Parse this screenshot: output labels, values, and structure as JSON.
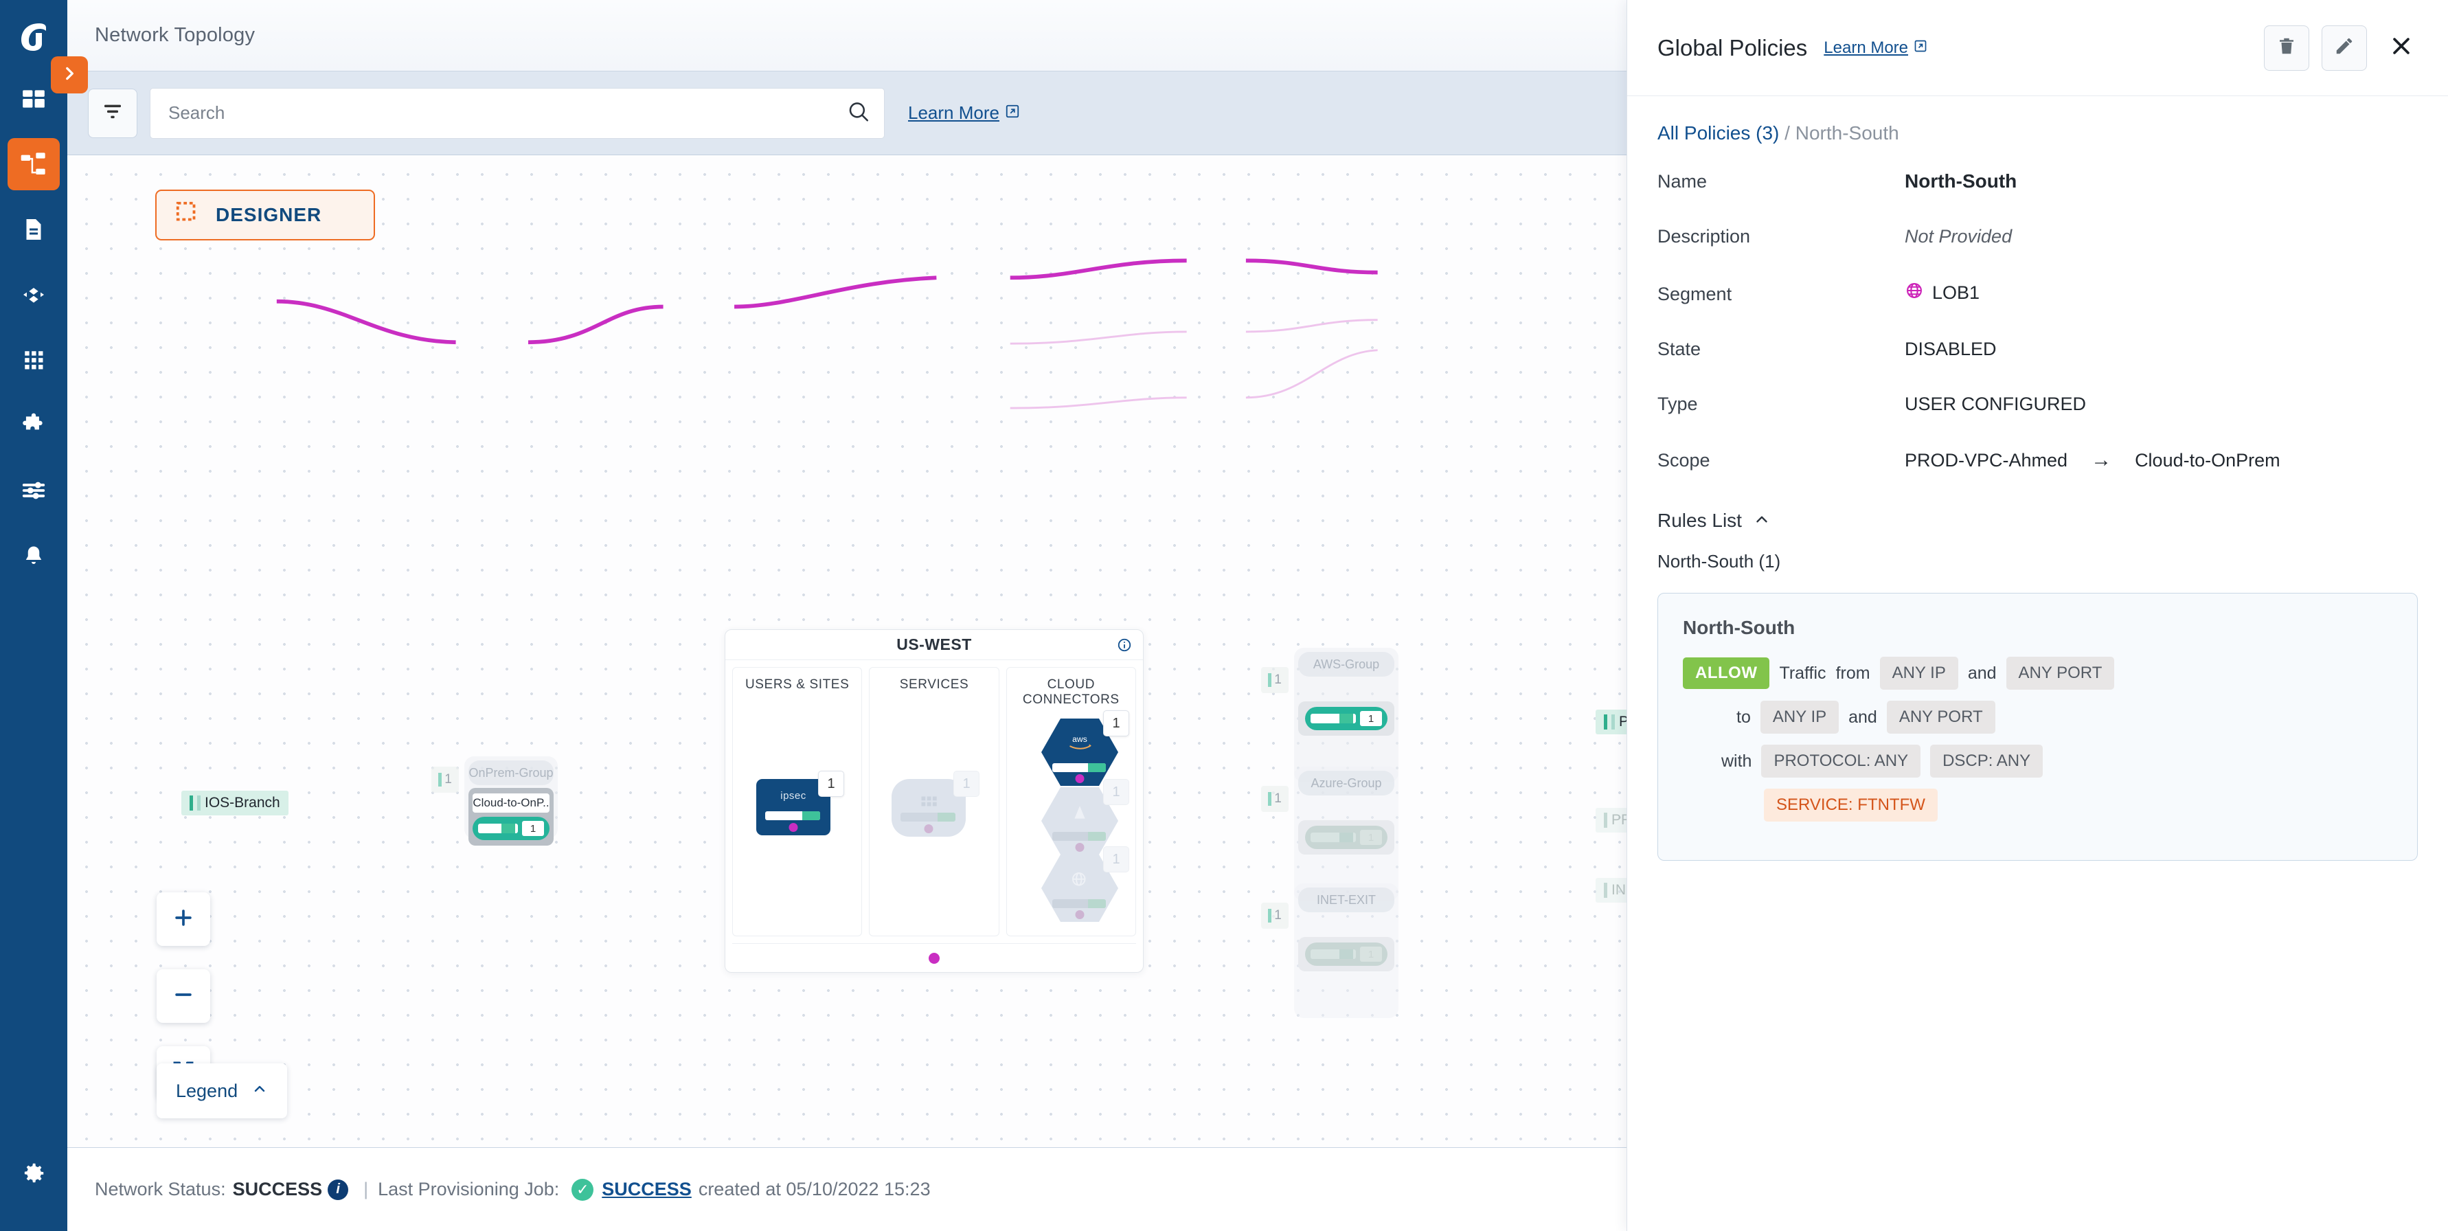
{
  "nav": {
    "logo": "arista-logo",
    "items": [
      {
        "name": "dashboard",
        "icon": "dashboard-icon",
        "active": false
      },
      {
        "name": "topology",
        "icon": "topology-icon",
        "active": true
      },
      {
        "name": "inventory",
        "icon": "document-icon",
        "active": false
      },
      {
        "name": "traffic",
        "icon": "diamond-flow-icon",
        "active": false
      },
      {
        "name": "apps",
        "icon": "grid-apps-icon",
        "active": false
      },
      {
        "name": "integrations",
        "icon": "puzzle-icon",
        "active": false
      },
      {
        "name": "settings-sliders",
        "icon": "sliders-icon",
        "active": false
      },
      {
        "name": "alerts",
        "icon": "bell-icon",
        "active": false
      }
    ],
    "bottom_item": {
      "name": "settings",
      "icon": "gear-icon"
    },
    "expand_tab_icon": "chevron-right-icon"
  },
  "topbar": {
    "title": "Network Topology"
  },
  "toolbar": {
    "filter_icon": "filter-icon",
    "search": {
      "placeholder": "Search",
      "value": "",
      "icon": "search-icon"
    },
    "learn_more": "Learn More",
    "learn_more_icon": "external-link-icon"
  },
  "canvas": {
    "designer_button": {
      "label": "DESIGNER",
      "icon": "marquee-select-icon"
    },
    "zoom_controls": [
      {
        "name": "zoom-in",
        "icon": "plus-icon"
      },
      {
        "name": "zoom-out",
        "icon": "minus-icon"
      },
      {
        "name": "fit-to-screen",
        "icon": "fit-screen-icon"
      }
    ],
    "legend": {
      "label": "Legend",
      "icon": "chevron-up-icon"
    },
    "region": {
      "title": "US-WEST",
      "info_icon": "info-icon",
      "columns": [
        "USERS & SITES",
        "SERVICES",
        "CLOUD CONNECTORS"
      ],
      "users_sites_node": {
        "label": "ipsec",
        "badge": "1"
      },
      "services_node": {
        "label": "",
        "badge": "1"
      },
      "cloud_connectors": [
        {
          "label": "aws",
          "badge": "1",
          "active": true
        },
        {
          "label": "azure",
          "badge": "1",
          "active": false
        },
        {
          "label": "internet",
          "badge": "1",
          "active": false
        }
      ]
    },
    "groups": [
      {
        "name": "OnPrem-Group",
        "count": "1",
        "node_label": "Cloud-to-OnP..",
        "pill_count": "1",
        "active": true
      },
      {
        "name": "AWS-Group",
        "count": "1",
        "node_label": "",
        "pill_count": "1",
        "active": true
      },
      {
        "name": "Azure-Group",
        "count": "1",
        "node_label": "",
        "pill_count": "1",
        "active": false
      },
      {
        "name": "INET-EXIT",
        "count": "1",
        "node_label": "",
        "pill_count": "1",
        "active": false
      }
    ],
    "endpoints": [
      {
        "label": "IOS-Branch",
        "active": true
      },
      {
        "label": "PROD-VPC-A..",
        "active": true
      },
      {
        "label": "PROD-Ahmed..",
        "active": false
      },
      {
        "label": "INET",
        "active": false
      }
    ]
  },
  "statusbar": {
    "network_status_label": "Network Status:",
    "network_status_value": "SUCCESS",
    "info_icon": "info-icon",
    "divider": "|",
    "job_label": "Last Provisioning Job:",
    "job_status": "SUCCESS",
    "job_check_icon": "check-circle-icon",
    "job_created": "created at 05/10/2022 15:23"
  },
  "panel": {
    "title": "Global Policies",
    "learn_more": "Learn More",
    "learn_more_icon": "external-link-icon",
    "actions": [
      {
        "name": "delete-policy",
        "icon": "trash-icon"
      },
      {
        "name": "edit-policy",
        "icon": "pencil-icon"
      },
      {
        "name": "close-panel",
        "icon": "close-icon"
      }
    ],
    "breadcrumb": {
      "root": "All Policies (3)",
      "separator": "/",
      "current": "North-South"
    },
    "fields": [
      {
        "key": "Name",
        "value": "North-South",
        "style": "strong"
      },
      {
        "key": "Description",
        "value": "Not Provided",
        "style": "muted-italic"
      },
      {
        "key": "Segment",
        "value": "LOB1",
        "icon": "globe-icon",
        "icon_color": "#cc22b8"
      },
      {
        "key": "State",
        "value": "DISABLED",
        "style": "normal"
      },
      {
        "key": "Type",
        "value": "USER CONFIGURED",
        "style": "normal"
      }
    ],
    "scope": {
      "key": "Scope",
      "from": "PROD-VPC-Ahmed",
      "arrow": "→",
      "to": "Cloud-to-OnPrem"
    },
    "rules": {
      "header": "Rules List",
      "collapse_icon": "chevron-up-icon",
      "group_label": "North-South (1)",
      "card": {
        "name": "North-South",
        "action": "ALLOW",
        "action_color": "#82c44b",
        "word_traffic": "Traffic",
        "word_from": "from",
        "word_and": "and",
        "word_to": "to",
        "word_with": "with",
        "src_ip": "ANY IP",
        "src_port": "ANY PORT",
        "dst_ip": "ANY IP",
        "dst_port": "ANY PORT",
        "protocol": "PROTOCOL: ANY",
        "dscp": "DSCP: ANY",
        "service": "SERVICE: FTNTFW"
      }
    }
  },
  "colors": {
    "brand_navy": "#114A7E",
    "brand_orange": "#EE6C23",
    "link_blue": "#12508f",
    "allow_green": "#82c44b",
    "service_orange": "#d4541a",
    "magenta": "#c92ec2",
    "teal": "#25b49a"
  }
}
